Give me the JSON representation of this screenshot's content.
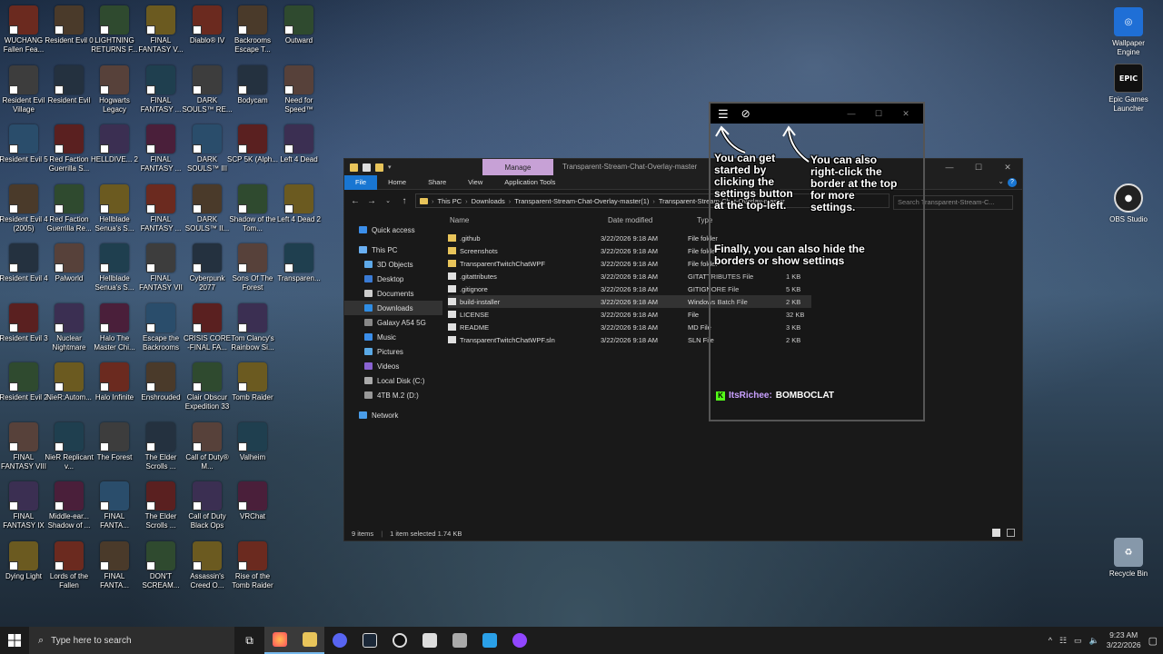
{
  "desktop": {
    "columns": [
      [
        "WUCHANG Fallen Fea...",
        "Resident Evil Village",
        "Resident Evil 5",
        "Resident Evil 4 (2005)",
        "Resident Evil 4",
        "Resident Evil 3",
        "Resident Evil 2",
        "FINAL FANTASY VIII",
        "FINAL FANTASY IX",
        "Dying Light"
      ],
      [
        "Resident Evil 0",
        "Resident Evil",
        "Red Faction Guerrilla S...",
        "Red Faction Guerrilla Re...",
        "Palworld",
        "Nuclear Nightmare",
        "NieR:Autom...",
        "NieR Replicant v...",
        "Middle-ear... Shadow of ...",
        "Lords of the Fallen"
      ],
      [
        "LIGHTNING RETURNS F...",
        "Hogwarts Legacy",
        "HELLDIVE... 2",
        "Hellblade Senua's S...",
        "Hellblade Senua's S...",
        "Halo The Master Chi...",
        "Halo Infinite",
        "The Forest",
        "FINAL FANTA...",
        "FINAL FANTA..."
      ],
      [
        "FINAL FANTASY V...",
        "FINAL FANTASY ...",
        "FINAL FANTASY ...",
        "FINAL FANTASY ...",
        "FINAL FANTASY VII",
        "Escape the Backrooms",
        "Enshrouded",
        "The Elder Scrolls ...",
        "The Elder Scrolls ...",
        "DON'T SCREAM..."
      ],
      [
        "Diablo® IV",
        "DARK SOULS™ RE...",
        "DARK SOULS™ III",
        "DARK SOULS™ II...",
        "Cyberpunk 2077",
        "CRISIS CORE -FINAL FA...",
        "Clair Obscur Expedition 33",
        "Call of Duty® M...",
        "Call of Duty Black Ops",
        "Assassin's Creed O..."
      ],
      [
        "Backrooms Escape T...",
        "Bodycam",
        "SCP 5K (Alph...",
        "Shadow of the Tom...",
        "Sons Of The Forest",
        "Tom Clancy's Rainbow Si...",
        "Tomb Raider",
        "Valheim",
        "VRChat",
        "Rise of the Tomb Raider"
      ],
      [
        "Outward",
        "Need for Speed™",
        "Left 4 Dead",
        "Left 4 Dead 2",
        "Transparen..."
      ]
    ],
    "right_icons": [
      "Wallpaper Engine",
      "Epic Games Launcher",
      "OBS Studio",
      "Recycle Bin"
    ]
  },
  "explorer": {
    "manage_tab": "Manage",
    "title": "Transparent-Stream-Chat-Overlay-master",
    "ribbon_tabs": [
      "File",
      "Home",
      "Share",
      "View",
      "Application Tools"
    ],
    "breadcrumb": [
      "This PC",
      "Downloads",
      "Transparent-Stream-Chat-Overlay-master(1)",
      "Transparent-Stream-Chat-Overlay-master"
    ],
    "search_placeholder": "Search Transparent-Stream-C...",
    "nav": [
      "Quick access",
      "This PC",
      "3D Objects",
      "Desktop",
      "Documents",
      "Downloads",
      "Galaxy A54 5G",
      "Music",
      "Pictures",
      "Videos",
      "Local Disk (C:)",
      "4TB M.2 (D:)",
      "Network"
    ],
    "columns": [
      "Name",
      "Date modified",
      "Type",
      "Size"
    ],
    "files": [
      {
        "name": ".github",
        "date": "3/22/2026 9:18 AM",
        "type": "File folder",
        "size": ""
      },
      {
        "name": "Screenshots",
        "date": "3/22/2026 9:18 AM",
        "type": "File folder",
        "size": ""
      },
      {
        "name": "TransparentTwitchChatWPF",
        "date": "3/22/2026 9:18 AM",
        "type": "File folder",
        "size": ""
      },
      {
        "name": ".gitattributes",
        "date": "3/22/2026 9:18 AM",
        "type": "GITATTRIBUTES File",
        "size": "1 KB"
      },
      {
        "name": ".gitignore",
        "date": "3/22/2026 9:18 AM",
        "type": "GITIGNORE File",
        "size": "5 KB"
      },
      {
        "name": "build-installer",
        "date": "3/22/2026 9:18 AM",
        "type": "Windows Batch File",
        "size": "2 KB"
      },
      {
        "name": "LICENSE",
        "date": "3/22/2026 9:18 AM",
        "type": "File",
        "size": "32 KB"
      },
      {
        "name": "README",
        "date": "3/22/2026 9:18 AM",
        "type": "MD File",
        "size": "3 KB"
      },
      {
        "name": "TransparentTwitchChatWPF.sln",
        "date": "3/22/2026 9:18 AM",
        "type": "SLN File",
        "size": "2 KB"
      }
    ],
    "status_items": "9 items",
    "status_selected": "1 item selected  1.74 KB"
  },
  "overlay": {
    "note_left": "You can get started by clicking the settings button at the top-left.",
    "note_right": "You can also right-click the border at the top for more settings.",
    "note_bottom": "Finally, you can also hide the borders or show settings",
    "chat_user": "ItsRichee:",
    "chat_message": "BOMBOCLAT",
    "user_color": "#c9a0ff"
  },
  "taskbar": {
    "search_placeholder": "Type here to search",
    "time": "9:23 AM",
    "date": "3/22/2026"
  }
}
